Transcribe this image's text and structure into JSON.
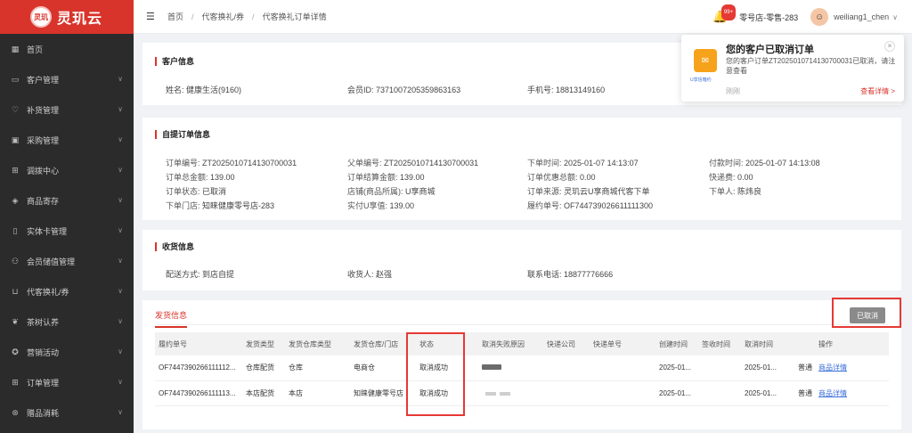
{
  "logo": {
    "badge": "灵玑",
    "text": "灵玑云"
  },
  "sidebar": {
    "items": [
      {
        "label": "首页",
        "icon": "grid-icon",
        "chev": false
      },
      {
        "label": "客户管理",
        "icon": "customer-icon",
        "chev": true
      },
      {
        "label": "补货管理",
        "icon": "replenish-icon",
        "chev": true
      },
      {
        "label": "采购管理",
        "icon": "purchase-icon",
        "chev": true
      },
      {
        "label": "调拨中心",
        "icon": "transfer-icon",
        "chev": true
      },
      {
        "label": "商品寄存",
        "icon": "box-icon",
        "chev": true
      },
      {
        "label": "实体卡管理",
        "icon": "card-icon",
        "chev": true
      },
      {
        "label": "会员储值管理",
        "icon": "member-icon",
        "chev": true
      },
      {
        "label": "代客换礼/券",
        "icon": "cart-icon",
        "chev": true
      },
      {
        "label": "茶树认养",
        "icon": "tree-icon",
        "chev": true
      },
      {
        "label": "营销活动",
        "icon": "marketing-icon",
        "chev": true
      },
      {
        "label": "订单管理",
        "icon": "order-icon",
        "chev": true
      },
      {
        "label": "赠品消耗",
        "icon": "gift-icon",
        "chev": true
      }
    ]
  },
  "breadcrumb": {
    "items": [
      "首页",
      "代客换礼/券",
      "代客换礼订单详情"
    ]
  },
  "header": {
    "badge": "99+",
    "store": "零号店-零售-283",
    "username": "weiliang1_chen"
  },
  "notification": {
    "title": "您的客户已取消订单",
    "body": "您的客户订单ZT2025010714130700031已取消，请注意查看",
    "time": "刚刚",
    "link": "查看详情 >",
    "icon_label": "U享信箱约"
  },
  "customer": {
    "title": "客户信息",
    "name_label": "姓名:",
    "name": "健康生活(9160)",
    "member_label": "会员ID:",
    "member": "7371007205359863163",
    "phone_label": "手机号:",
    "phone": "18813149160"
  },
  "order": {
    "title": "自提订单信息",
    "fields": [
      [
        "订单编号:",
        "ZT2025010714130700031"
      ],
      [
        "父单编号:",
        "ZT2025010714130700031"
      ],
      [
        "下单时间:",
        "2025-01-07 14:13:07"
      ],
      [
        "付款时间:",
        "2025-01-07 14:13:08"
      ],
      [
        "订单总金额:",
        "139.00"
      ],
      [
        "订单结算金额:",
        "139.00"
      ],
      [
        "订单优惠总额:",
        "0.00"
      ],
      [
        "快递费:",
        "0.00"
      ],
      [
        "订单状态:",
        "已取消"
      ],
      [
        "店铺(商品所属):",
        "U享商城"
      ],
      [
        "订单来源:",
        "灵玑云U享商城代客下单"
      ],
      [
        "下单人:",
        "陈炜良"
      ],
      [
        "下单门店:",
        "知睐健康零号店-283"
      ],
      [
        "实付U享值:",
        "139.00"
      ],
      [
        "履约单号:",
        "OF744739026611111300"
      ]
    ]
  },
  "receive": {
    "title": "收货信息",
    "mode_label": "配送方式:",
    "mode": "到店自提",
    "recv_label": "收货人:",
    "recv": "赵强",
    "tel_label": "联系电话:",
    "tel": "18877776666"
  },
  "shipping": {
    "tab": "发货信息",
    "status_button": "已取消",
    "columns": [
      "履约单号",
      "发货类型",
      "发货仓库类型",
      "发货仓库/门店",
      "状态",
      "取消失败原因",
      "快递公司",
      "快递单号",
      "创建时间",
      "签收时间",
      "取消时间",
      "",
      "操作"
    ],
    "rows": [
      [
        "OF7447390266111112...",
        "仓库配货",
        "仓库",
        "电商仓",
        "取消成功",
        "",
        "",
        "",
        "2025-01...",
        "",
        "2025-01...",
        "普通",
        "商品详情"
      ],
      [
        "OF7447390266111113...",
        "本店配货",
        "本店",
        "知睐健康零号店",
        "取消成功",
        "",
        "",
        "",
        "2025-01...",
        "",
        "2025-01...",
        "普通",
        "商品详情"
      ]
    ]
  },
  "colors": {
    "accent": "#d9342b",
    "sidebar": "#2b2b2b",
    "link": "#3a6fd8"
  }
}
